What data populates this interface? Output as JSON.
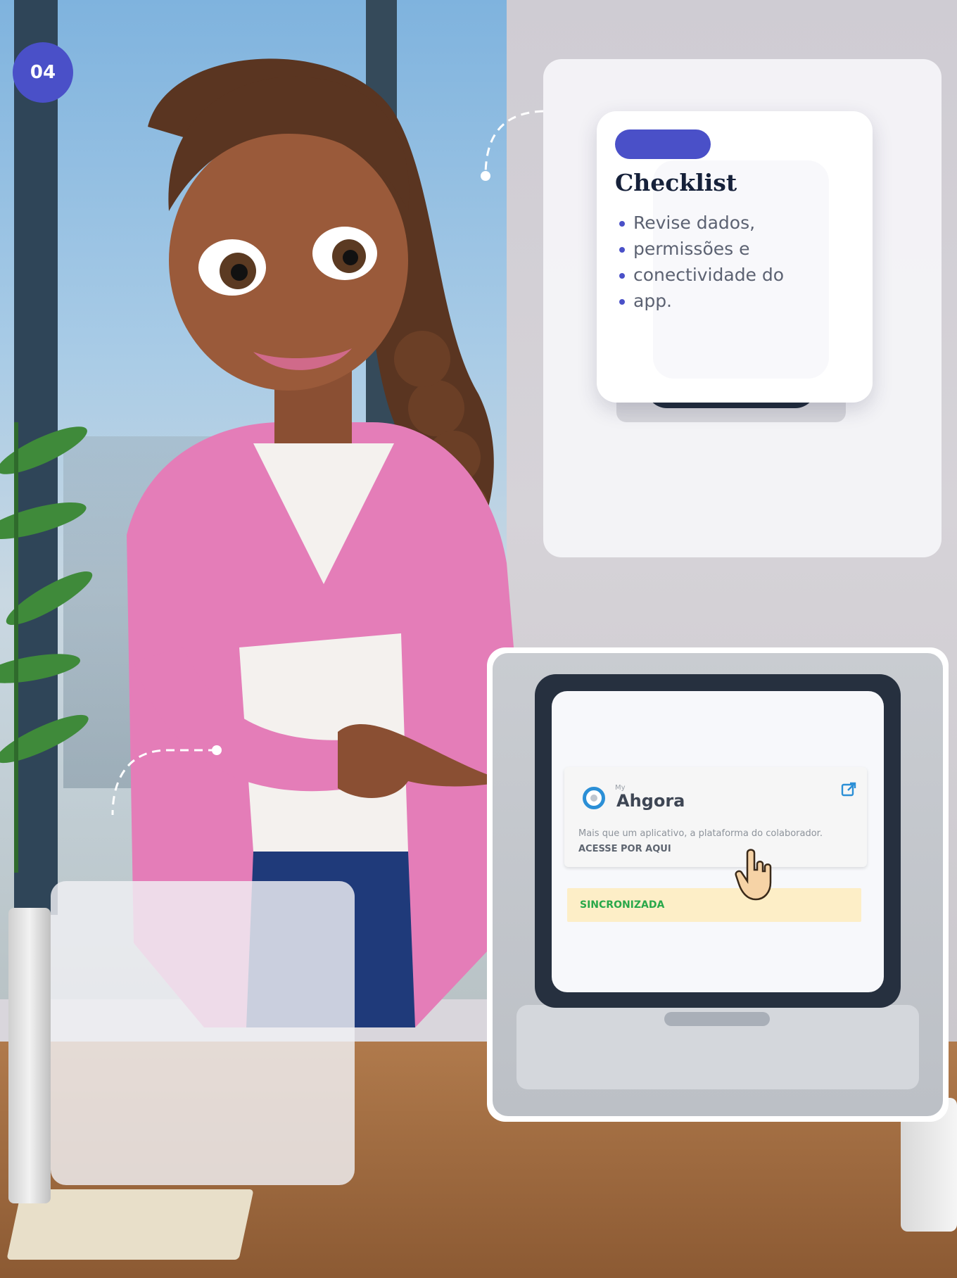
{
  "step": {
    "number": "04"
  },
  "checklist": {
    "title": "Checklist",
    "items": [
      "Revise dados,",
      "permissões e",
      "conectividade do",
      "app."
    ]
  },
  "ahgora_widget": {
    "brand_prefix": "My",
    "brand_name": "Ahgora",
    "description": "Mais que um aplicativo, a plataforma do colaborador.",
    "cta": "ACESSE POR AQUI",
    "status": "SINCRONIZADA"
  },
  "colors": {
    "accent": "#4a50c8",
    "title": "#16213a",
    "status_text": "#29a84a",
    "status_bg": "#fdeec7",
    "brand_blue": "#2b8fd6"
  },
  "icons": [
    "external-link-icon",
    "pointer-hand-icon",
    "ahgora-logo-icon"
  ]
}
